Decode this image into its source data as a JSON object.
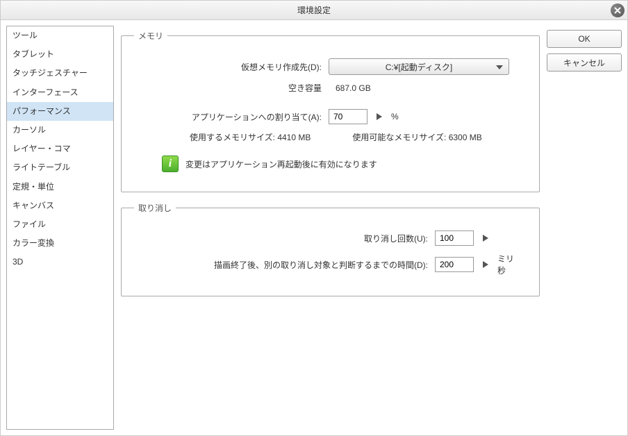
{
  "window": {
    "title": "環境設定"
  },
  "sidebar": {
    "items": [
      "ツール",
      "タブレット",
      "タッチジェスチャー",
      "インターフェース",
      "パフォーマンス",
      "カーソル",
      "レイヤー・コマ",
      "ライトテーブル",
      "定規・単位",
      "キャンバス",
      "ファイル",
      "カラー変換",
      "3D"
    ],
    "selectedIndex": 4
  },
  "buttons": {
    "ok": "OK",
    "cancel": "キャンセル"
  },
  "memory": {
    "legend": "メモリ",
    "vm_label": "仮想メモリ作成先(D):",
    "vm_value": "C:¥[起動ディスク]",
    "free_label": "空き容量",
    "free_value": "687.0 GB",
    "alloc_label": "アプリケーションへの割り当て(A):",
    "alloc_value": "70",
    "alloc_unit": "%",
    "used_label": "使用するメモリサイズ:",
    "used_value": "4410 MB",
    "avail_label": "使用可能なメモリサイズ:",
    "avail_value": "6300 MB",
    "notice": "変更はアプリケーション再起動後に有効になります"
  },
  "undo": {
    "legend": "取り消し",
    "count_label": "取り消し回数(U):",
    "count_value": "100",
    "delay_label": "描画終了後、別の取り消し対象と判断するまでの時間(D):",
    "delay_value": "200",
    "delay_unit": "ミリ秒"
  }
}
